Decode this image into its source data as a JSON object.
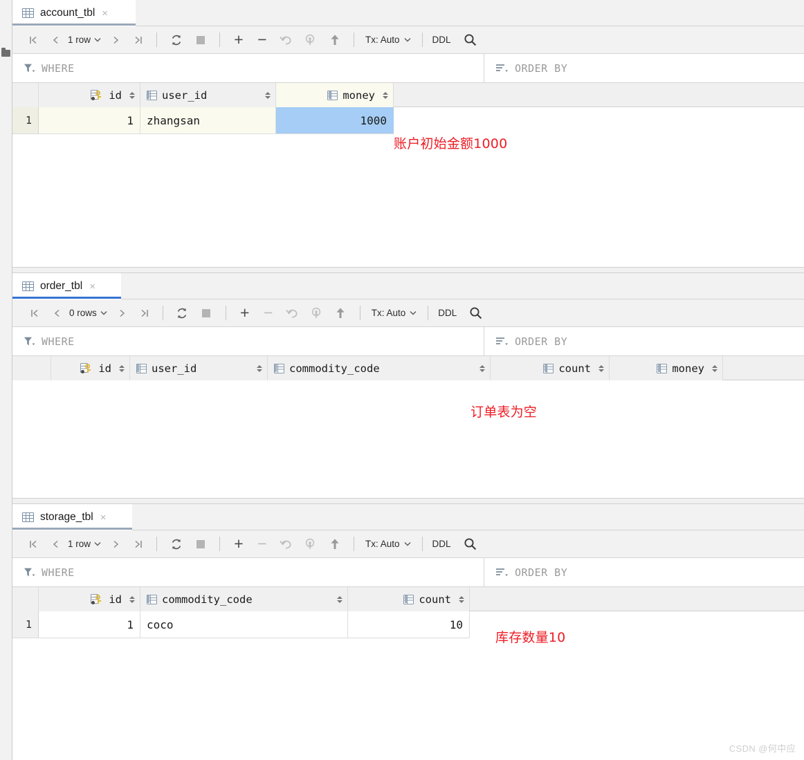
{
  "sidebar": {
    "label": "Project",
    "folder_icon": "folder-icon"
  },
  "toolbar_common": {
    "first_label": "|<",
    "prev_label": "<",
    "next_label": ">",
    "last_label": ">|",
    "caret": "⌄",
    "refresh_icon": "refresh-icon",
    "stop_icon": "stop-icon",
    "add_label": "+",
    "remove_label": "−",
    "undo_icon": "undo-icon",
    "revert_icon": "revert-icon",
    "commit_icon": "upload-icon",
    "tx_label": "Tx: Auto",
    "ddl_label": "DDL",
    "search_icon": "search-icon"
  },
  "filter": {
    "where_label": "WHERE",
    "order_by_label": "ORDER BY",
    "filter_icon": "filter-icon",
    "sort-icon": "sort-icon"
  },
  "colors": {
    "annotation_red": "#ee1c25",
    "selected_cell_blue": "#a5cdf5",
    "highlight_row_cream": "#fbfaef",
    "active_tab_underline": "#3573d4",
    "inactive_tab_underline": "#9aa7b8",
    "key_gold": "#e2b83c"
  },
  "panels": [
    {
      "tab_label": "account_tbl",
      "tab_close": "×",
      "tab_active": false,
      "row_count_label": "1 row",
      "columns": [
        {
          "name": "id",
          "icon": "primary-key-icon",
          "align": "right"
        },
        {
          "name": "user_id",
          "icon": "column-icon",
          "align": "left"
        },
        {
          "name": "money",
          "icon": "column-icon",
          "align": "right",
          "selected": true
        }
      ],
      "rows": [
        {
          "num": "1",
          "highlight": true,
          "cells": [
            "1",
            "zhangsan",
            "1000"
          ],
          "selected_index": 2
        }
      ],
      "annotation": "账户初始金额1000"
    },
    {
      "tab_label": "order_tbl",
      "tab_close": "×",
      "tab_active": true,
      "row_count_label": "0 rows",
      "columns": [
        {
          "name": "id",
          "icon": "primary-key-icon",
          "align": "right"
        },
        {
          "name": "user_id",
          "icon": "column-icon",
          "align": "left"
        },
        {
          "name": "commodity_code",
          "icon": "column-icon",
          "align": "left"
        },
        {
          "name": "count",
          "icon": "column-icon",
          "align": "right"
        },
        {
          "name": "money",
          "icon": "column-icon",
          "align": "right"
        }
      ],
      "rows": [],
      "annotation": "订单表为空"
    },
    {
      "tab_label": "storage_tbl",
      "tab_close": "×",
      "tab_active": false,
      "row_count_label": "1 row",
      "columns": [
        {
          "name": "id",
          "icon": "primary-key-icon",
          "align": "right"
        },
        {
          "name": "commodity_code",
          "icon": "column-icon",
          "align": "left"
        },
        {
          "name": "count",
          "icon": "column-icon",
          "align": "right"
        }
      ],
      "rows": [
        {
          "num": "1",
          "highlight": false,
          "cells": [
            "1",
            "coco",
            "10"
          ],
          "selected_index": -1
        }
      ],
      "annotation": "库存数量10"
    }
  ],
  "watermark": "CSDN @何中应"
}
